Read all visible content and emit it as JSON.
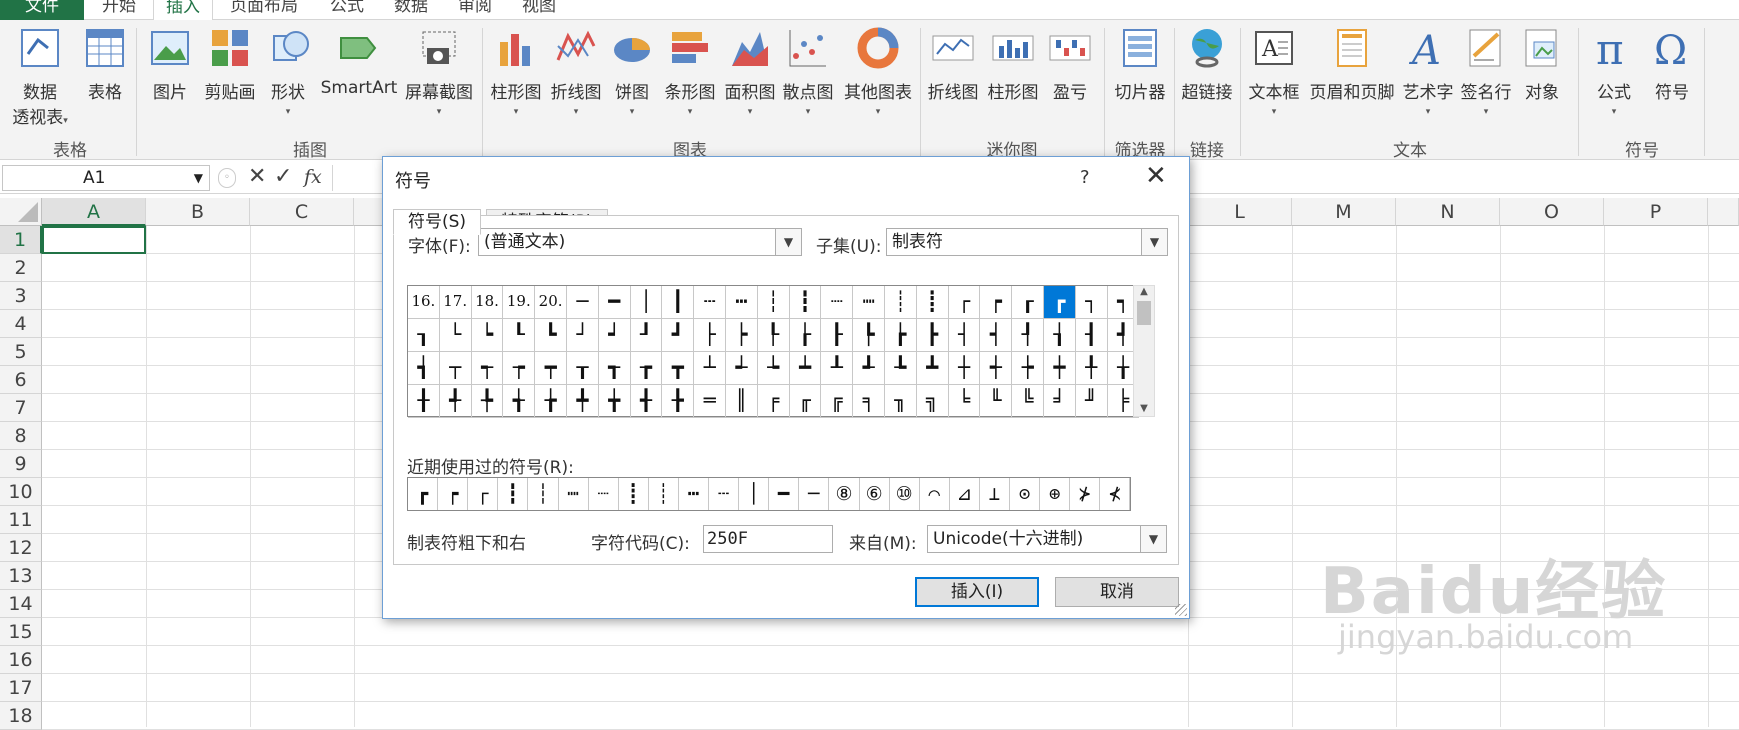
{
  "tabs": [
    "文件",
    "开始",
    "插入",
    "页面布局",
    "公式",
    "数据",
    "审阅",
    "视图"
  ],
  "ribbon": {
    "buttons": [
      "数据",
      "透视表",
      "表格",
      "图片",
      "剪贴画",
      "形状",
      "SmartArt",
      "屏幕截图",
      "柱形图",
      "折线图",
      "饼图",
      "条形图",
      "面积图",
      "散点图",
      "其他图表",
      "折线图",
      "柱形图",
      "盈亏",
      "切片器",
      "超链接",
      "文本框",
      "页眉和页脚",
      "艺术字",
      "签名行",
      "对象",
      "公式",
      "符号"
    ],
    "groups": [
      "表格",
      "插图",
      "图表",
      "迷你图",
      "筛选器",
      "链接",
      "文本",
      "符号"
    ]
  },
  "namebox": "A1",
  "fx": "fx",
  "columns": [
    "A",
    "B",
    "C",
    "L",
    "M",
    "N",
    "O",
    "P"
  ],
  "rows": [
    "1",
    "2",
    "3",
    "4",
    "5",
    "6",
    "7",
    "8",
    "9",
    "10",
    "11",
    "12",
    "13",
    "14",
    "15",
    "16",
    "17",
    "18"
  ],
  "dialog": {
    "title": "符号",
    "help": "?",
    "tab_symbols": "符号(S)",
    "tab_special": "特殊字符(P)",
    "font_label": "字体(F):",
    "font_value": "(普通文本)",
    "subset_label": "子集(U):",
    "subset_value": "制表符",
    "symbols": [
      [
        "16.",
        "17.",
        "18.",
        "19.",
        "20.",
        "─",
        "━",
        "│",
        "┃",
        "┄",
        "┅",
        "┆",
        "┇",
        "┈",
        "┉",
        "┊",
        "┋",
        "┌",
        "┍",
        "┎",
        "┏",
        "┐",
        "┑"
      ],
      [
        "┒",
        "└",
        "┕",
        "┖",
        "┗",
        "┘",
        "┙",
        "┚",
        "┛",
        "├",
        "┝",
        "┞",
        "┟",
        "┠",
        "┡",
        "┢",
        "┣",
        "┤",
        "┥",
        "┦",
        "┧",
        "┨",
        "┩"
      ],
      [
        "┪",
        "┬",
        "┭",
        "┮",
        "┯",
        "┰",
        "┱",
        "┲",
        "┳",
        "┴",
        "┵",
        "┶",
        "┷",
        "┸",
        "┹",
        "┺",
        "┻",
        "┼",
        "┽",
        "┾",
        "┿",
        "╀",
        "╁"
      ],
      [
        "╂",
        "╃",
        "╄",
        "╅",
        "╆",
        "╇",
        "╈",
        "╉",
        "╊",
        "═",
        "║",
        "╒",
        "╓",
        "╔",
        "╕",
        "╖",
        "╗",
        "╘",
        "╙",
        "╚",
        "╛",
        "╜",
        "╞"
      ]
    ],
    "recent_label": "近期使用过的符号(R):",
    "recent": [
      "┏",
      "┍",
      "┌",
      "┇",
      "┆",
      "┉",
      "┈",
      "┋",
      "┊",
      "┅",
      "┄",
      "│",
      "━",
      "─",
      "⑧",
      "⑥",
      "⑩",
      "⌒",
      "⊿",
      "⊥",
      "⊙",
      "⊕",
      "⊁",
      "⊀"
    ],
    "char_name": "制表符粗下和右",
    "code_label": "字符代码(C):",
    "code_value": "250F",
    "from_label": "来自(M):",
    "from_value": "Unicode(十六进制)",
    "insert_button": "插入(I)",
    "cancel_button": "取消"
  },
  "watermark": "Baidu经验",
  "watermark_url": "jingyan.baidu.com",
  "colors": {
    "accent": "#217346",
    "selection": "#0078d7"
  }
}
